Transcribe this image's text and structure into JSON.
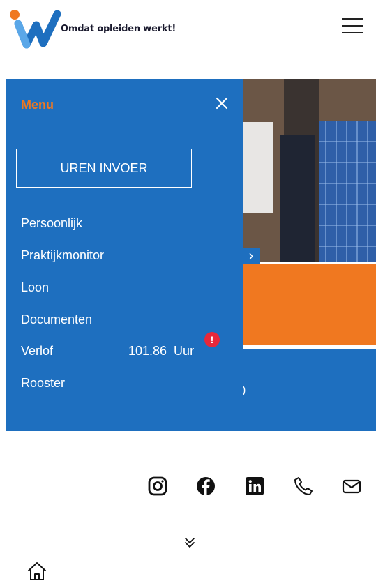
{
  "header": {
    "tagline": "Omdat opleiden werkt!",
    "logo_icon": "w-logo-icon",
    "menu_icon": "hamburger-icon"
  },
  "menu": {
    "title": "Menu",
    "close_icon": "close-icon",
    "hours_button": "UREN INVOER",
    "items": [
      {
        "label": "Persoonlijk"
      },
      {
        "label": "Praktijkmonitor"
      },
      {
        "label": "Loon"
      },
      {
        "label": "Documenten"
      },
      {
        "label": "Verlof",
        "value": "101.86  Uur",
        "badge": "!"
      },
      {
        "label": "Rooster"
      }
    ]
  },
  "social": [
    "instagram-icon",
    "facebook-icon",
    "linkedin-icon",
    "phone-icon",
    "mail-icon"
  ],
  "footer": {
    "scroll_icon": "chevron-double-down-icon",
    "home_icon": "home-icon"
  },
  "colors": {
    "menu_bg": "#1e6fbf",
    "accent_orange": "#f07820",
    "alert_red": "#e8283a"
  }
}
